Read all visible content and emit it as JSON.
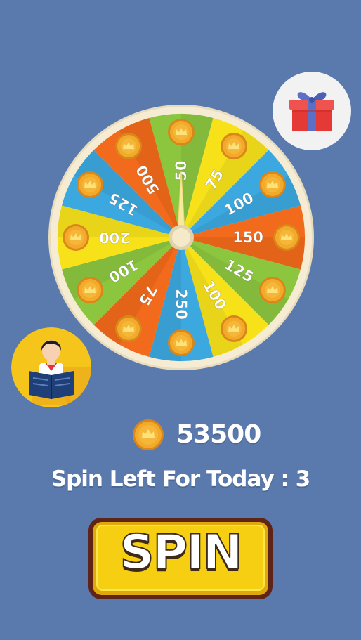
{
  "wheel": {
    "segments": [
      {
        "label": "50",
        "color": "#8cc63f"
      },
      {
        "label": "75",
        "color": "#f7e21a"
      },
      {
        "label": "100",
        "color": "#3ca8e0"
      },
      {
        "label": "150",
        "color": "#f26a1b"
      },
      {
        "label": "125",
        "color": "#8cc63f"
      },
      {
        "label": "100",
        "color": "#f7e21a"
      },
      {
        "label": "250",
        "color": "#3ca8e0"
      },
      {
        "label": "75",
        "color": "#f26a1b"
      },
      {
        "label": "100",
        "color": "#8cc63f"
      },
      {
        "label": "200",
        "color": "#f7e21a"
      },
      {
        "label": "125",
        "color": "#3ca8e0"
      },
      {
        "label": "500",
        "color": "#f26a1b"
      }
    ],
    "rim_color": "#f6ecd3",
    "pointer_color": "#f7ea9a"
  },
  "balance": {
    "coins": "53500",
    "icon": "coin-icon"
  },
  "spins_left_text": "Spin Left For Today : 3",
  "spin_button": {
    "label": "SPIN"
  },
  "gift": {
    "icon": "gift-icon"
  },
  "avatar": {
    "icon": "reading-person-icon"
  },
  "colors": {
    "background": "#5a7aad",
    "coin": "#f3a92a",
    "button_yellow": "#f6cf12",
    "button_border": "#5e2418"
  }
}
